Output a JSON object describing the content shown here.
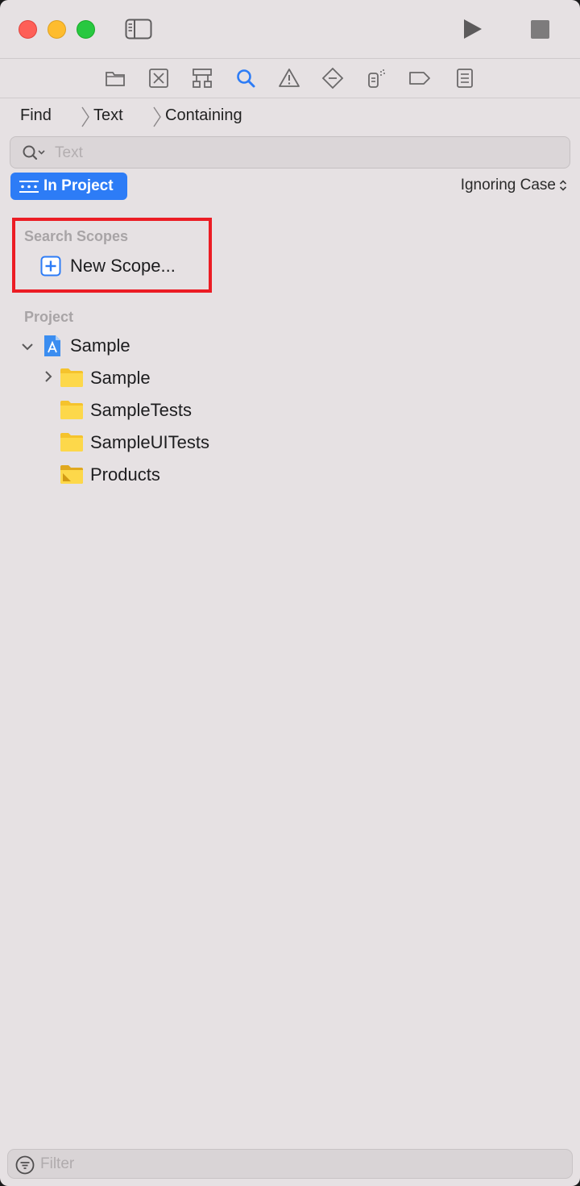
{
  "toolbar": {
    "icons": [
      "sidebar-toggle-icon",
      "play-icon",
      "stop-icon"
    ]
  },
  "navigator_tabs": [
    "project-navigator-icon",
    "source-control-icon",
    "symbol-navigator-icon",
    "find-navigator-icon",
    "issue-navigator-icon",
    "test-navigator-icon",
    "debug-navigator-icon",
    "breakpoint-navigator-icon",
    "report-navigator-icon"
  ],
  "accent_color": "#2d7cf6",
  "find_bar": {
    "mode": "Find",
    "type": "Text",
    "match": "Containing"
  },
  "search": {
    "placeholder": "Text"
  },
  "scope": {
    "label": "In Project",
    "case": "Ignoring Case"
  },
  "search_scopes": {
    "header": "Search Scopes",
    "new_scope": "New Scope..."
  },
  "project": {
    "header": "Project",
    "root": "Sample",
    "children": [
      "Sample",
      "SampleTests",
      "SampleUITests",
      "Products"
    ]
  },
  "filter": {
    "placeholder": "Filter"
  }
}
